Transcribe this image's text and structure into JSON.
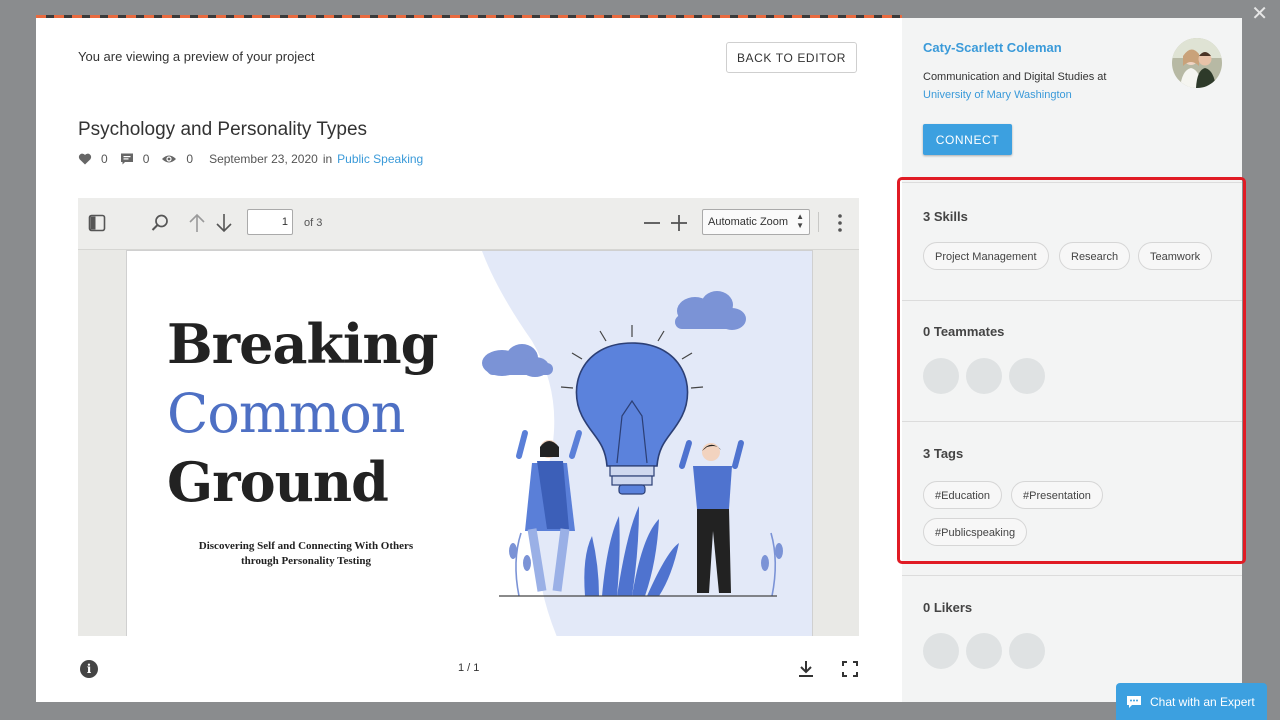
{
  "preview": {
    "note": "You are viewing a preview of your project",
    "back_label": "BACK TO EDITOR"
  },
  "project": {
    "title": "Psychology and Personality Types",
    "likes": "0",
    "comments": "0",
    "views": "0",
    "date": "September 23, 2020",
    "in_word": "in",
    "category": "Public Speaking"
  },
  "viewer": {
    "page_input": "1",
    "page_of": "of 3",
    "zoom": "Automatic Zoom",
    "page_count": "1 / 1"
  },
  "slide": {
    "line1": "Breaking",
    "line2": "Common",
    "line3": "Ground",
    "subtitle_line1": "Discovering Self and Connecting With Others",
    "subtitle_line2": "through Personality Testing"
  },
  "profile": {
    "name": "Caty-Scarlett Coleman",
    "role": "Communication and Digital Studies at",
    "school": "University of Mary Washington",
    "connect_label": "CONNECT"
  },
  "skills": {
    "title": "3 Skills",
    "items": [
      "Project Management",
      "Research",
      "Teamwork"
    ]
  },
  "teammates": {
    "title": "0 Teammates"
  },
  "tags": {
    "title": "3 Tags",
    "items": [
      "#Education",
      "#Presentation",
      "#Publicspeaking"
    ]
  },
  "likers": {
    "title": "0 Likers"
  },
  "chat": {
    "label": "Chat with an Expert"
  },
  "colors": {
    "accent": "#3ca0e0",
    "link": "#3a9ad9",
    "highlight": "#e01b24",
    "slide_blue": "#4e70c4"
  }
}
